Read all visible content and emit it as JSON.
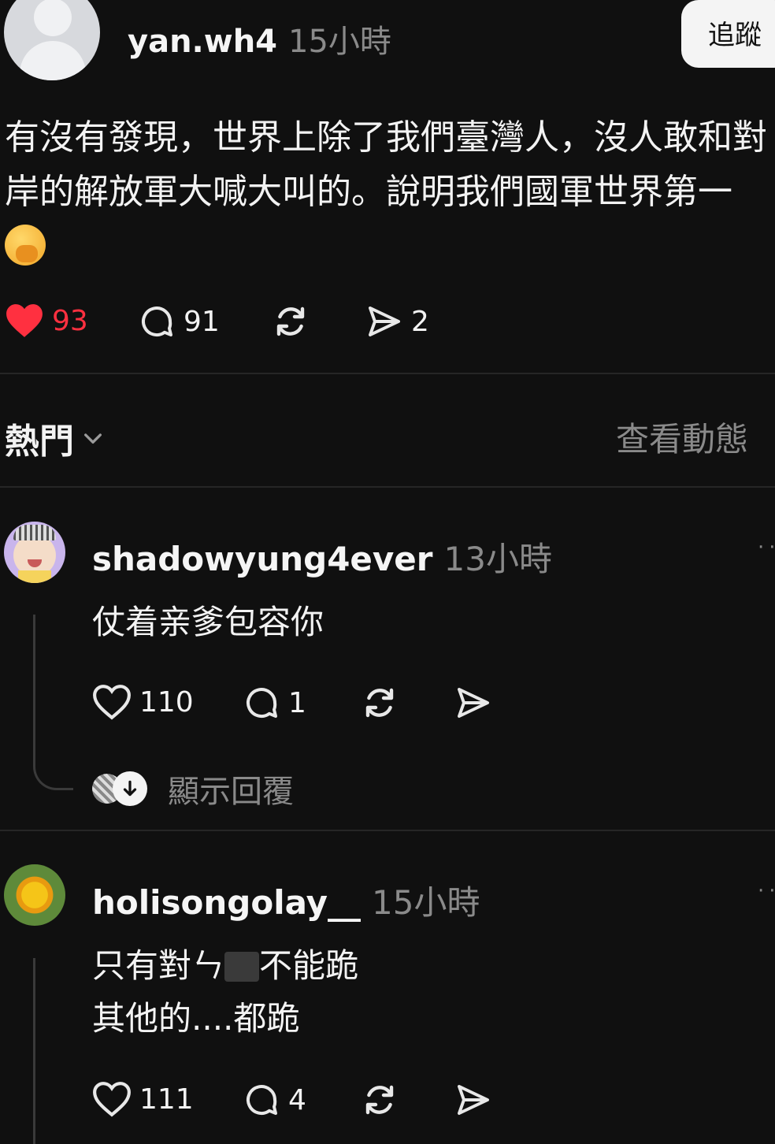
{
  "post": {
    "username": "yan.wh4",
    "time": "15小時",
    "follow_label": "追蹤",
    "text": "有沒有發現，世界上除了我們臺灣人，沒人敢和對岸的解放軍大喊大叫的。說明我們國軍世界第一",
    "emoji_icon": "face-with-hand-over-mouth-icon",
    "likes": "93",
    "comments": "91",
    "shares": "2",
    "liked_color": "#ff3040"
  },
  "sort": {
    "label": "熱門",
    "activity_label": "查看動態"
  },
  "comments": [
    {
      "username": "shadowyung4ever",
      "time": "13小時",
      "text": "仗着亲爹包容你",
      "likes": "110",
      "replies": "1",
      "show_replies_label": "顯示回覆"
    },
    {
      "username": "holisongolay__",
      "time": "15小時",
      "text_line1_a": "只有對ㄣ",
      "text_line1_b": "不能跪",
      "text_line2": "其他的....都跪",
      "likes": "111",
      "replies": "4"
    }
  ]
}
